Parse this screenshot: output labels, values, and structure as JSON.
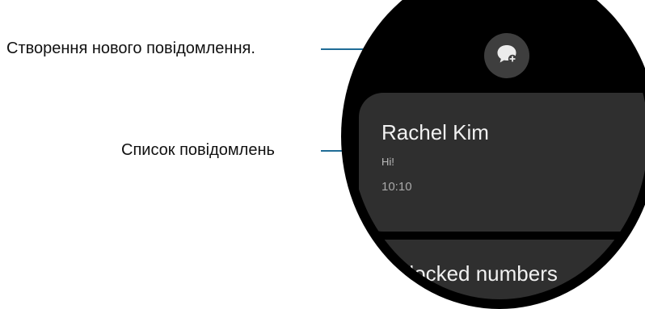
{
  "callouts": {
    "compose": "Створення нового повідомлення.",
    "list": "Список повідомлень"
  },
  "watch": {
    "compose_icon": "new-message-icon",
    "conversation": {
      "name": "Rachel Kim",
      "preview": "Hi!",
      "time": "10:10"
    },
    "blocked_label": "Blocked numbers"
  },
  "colors": {
    "leader": "#1f6c96",
    "card": "#2f2f2f",
    "compose_button": "#3e3e3e"
  }
}
